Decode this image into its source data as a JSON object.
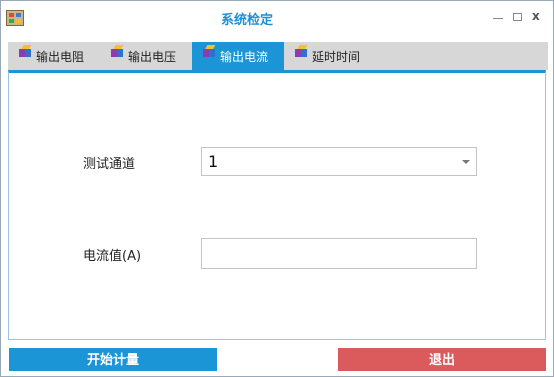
{
  "window": {
    "title": "系统检定",
    "controls": {
      "minimize": "–",
      "maximize": "□",
      "close": "x"
    }
  },
  "tabs": [
    {
      "label": "输出电阻",
      "icon": "cube-icon",
      "active": false
    },
    {
      "label": "输出电压",
      "icon": "cube-icon",
      "active": false
    },
    {
      "label": "输出电流",
      "icon": "cube-icon",
      "active": true
    },
    {
      "label": "延时时间",
      "icon": "cube-icon",
      "active": false
    }
  ],
  "form": {
    "channel_label": "测试通道",
    "channel_value": "1",
    "current_label": "电流值(A)",
    "current_value": ""
  },
  "buttons": {
    "start": "开始计量",
    "exit": "退出"
  },
  "colors": {
    "accent": "#1b95d6",
    "title": "#1f8fd6",
    "exit": "#db5b5d",
    "tabstrip": "#d7d7d7"
  }
}
